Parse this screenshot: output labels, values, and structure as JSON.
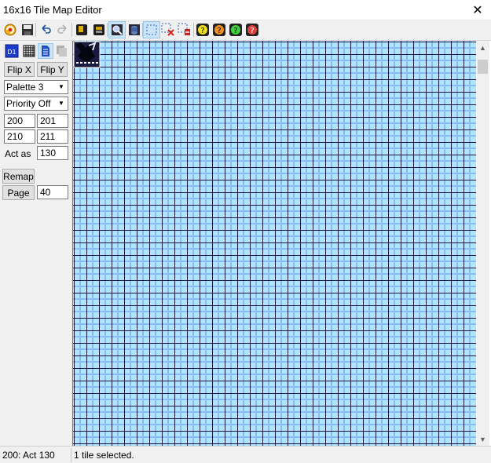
{
  "window": {
    "title": "16x16 Tile Map Editor",
    "close_glyph": "✕"
  },
  "toolbar": {
    "buttons": [
      "refresh-icon",
      "save-icon",
      "undo-icon",
      "redo-icon",
      "tile-icon",
      "tile-dark-icon",
      "zoom-icon",
      "stack-icon",
      "select-rect-icon",
      "clear-icon",
      "clear-area-icon",
      "help-yellow-icon",
      "help-orange-icon",
      "help-green-icon",
      "help-red-icon"
    ]
  },
  "left_panel": {
    "layer_badge": "D1",
    "flip_x": "Flip X",
    "flip_y": "Flip Y",
    "palette_select": "Palette 3",
    "priority_select": "Priority Off",
    "tiles": [
      "200",
      "201",
      "210",
      "211"
    ],
    "act_as_label": "Act as",
    "act_as_value": "130",
    "remap": "Remap",
    "page_label": "Page",
    "page_value": "40"
  },
  "map": {
    "tile_colors": {
      "fill": "#b2e4ff",
      "shade": "#87c0f0",
      "grid": "#15153a"
    },
    "selected_tile": "black-tile"
  },
  "statusbar": {
    "left": "200: Act 130",
    "right": "1 tile selected."
  }
}
